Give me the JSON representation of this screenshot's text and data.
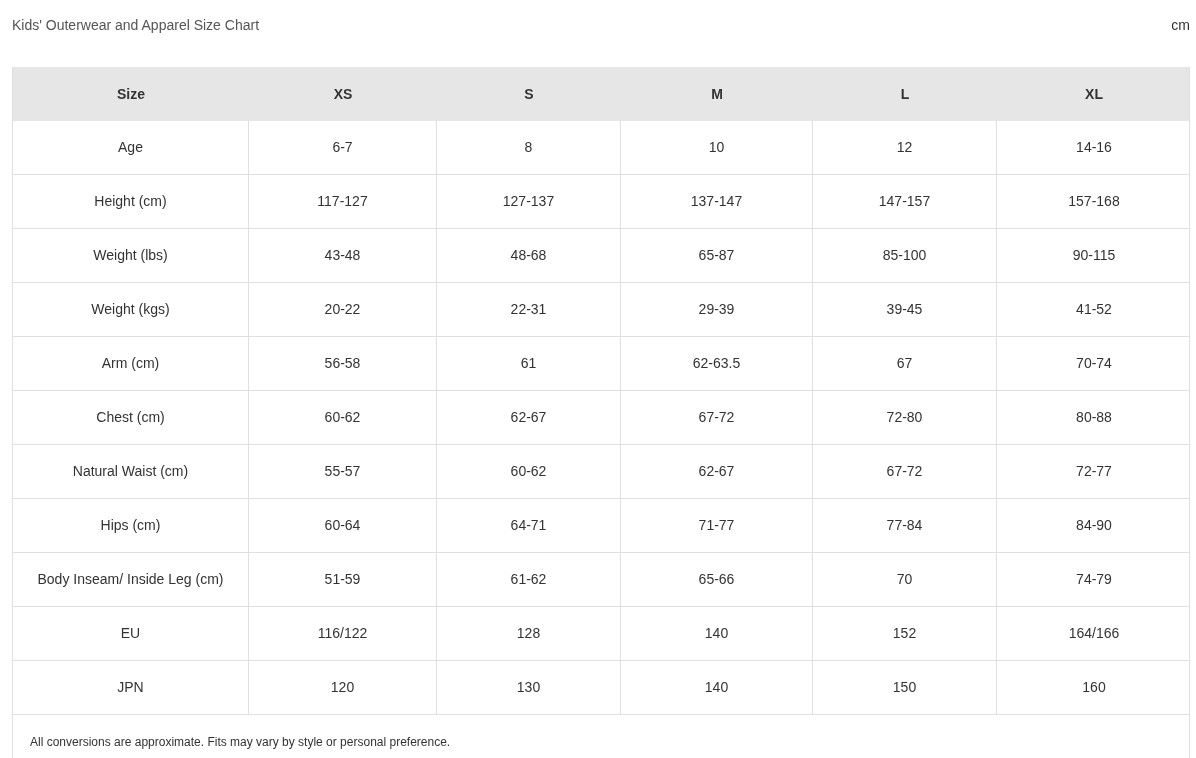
{
  "title": "Kids' Outerwear and Apparel Size Chart",
  "unit": "cm",
  "table": {
    "columns": [
      "Size",
      "XS",
      "S",
      "M",
      "L",
      "XL"
    ],
    "rows": [
      [
        "Age",
        "6-7",
        "8",
        "10",
        "12",
        "14-16"
      ],
      [
        "Height (cm)",
        "117-127",
        "127-137",
        "137-147",
        "147-157",
        "157-168"
      ],
      [
        "Weight (lbs)",
        "43-48",
        "48-68",
        "65-87",
        "85-100",
        "90-115"
      ],
      [
        "Weight (kgs)",
        "20-22",
        "22-31",
        "29-39",
        "39-45",
        "41-52"
      ],
      [
        "Arm (cm)",
        "56-58",
        "61",
        "62-63.5",
        "67",
        "70-74"
      ],
      [
        "Chest (cm)",
        "60-62",
        "62-67",
        "67-72",
        "72-80",
        "80-88"
      ],
      [
        "Natural Waist (cm)",
        "55-57",
        "60-62",
        "62-67",
        "67-72",
        "72-77"
      ],
      [
        "Hips (cm)",
        "60-64",
        "64-71",
        "71-77",
        "77-84",
        "84-90"
      ],
      [
        "Body Inseam/ Inside Leg (cm)",
        "51-59",
        "61-62",
        "65-66",
        "70",
        "74-79"
      ],
      [
        "EU",
        "116/122",
        "128",
        "140",
        "152",
        "164/166"
      ],
      [
        "JPN",
        "120",
        "130",
        "140",
        "150",
        "160"
      ]
    ],
    "footnote": "All conversions are approximate. Fits may vary by style or personal preference."
  }
}
